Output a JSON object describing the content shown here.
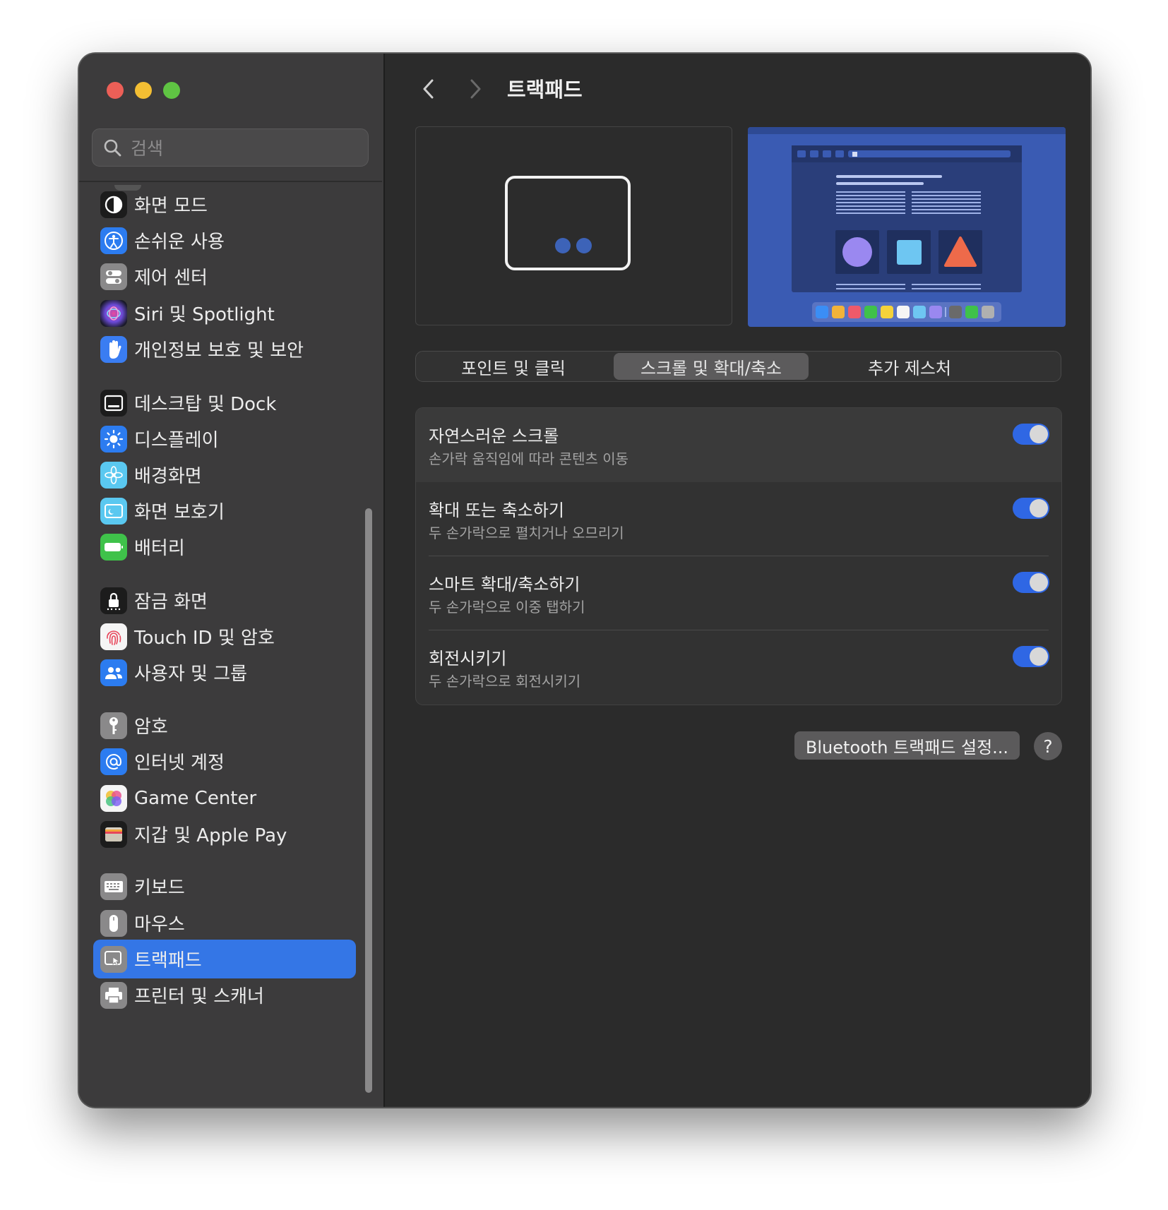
{
  "window": {
    "title": "트랙패드"
  },
  "search": {
    "placeholder": "검색",
    "value": ""
  },
  "sidebar": {
    "items": [
      {
        "label": "화면 모드",
        "icon": "appearance-icon"
      },
      {
        "label": "손쉬운 사용",
        "icon": "accessibility-icon"
      },
      {
        "label": "제어 센터",
        "icon": "control-center-icon"
      },
      {
        "label": "Siri 및 Spotlight",
        "icon": "siri-icon"
      },
      {
        "label": "개인정보 보호 및 보안",
        "icon": "privacy-hand-icon"
      },
      {
        "label": "데스크탑 및 Dock",
        "icon": "desktop-dock-icon"
      },
      {
        "label": "디스플레이",
        "icon": "display-sun-icon"
      },
      {
        "label": "배경화면",
        "icon": "wallpaper-flower-icon"
      },
      {
        "label": "화면 보호기",
        "icon": "screensaver-icon"
      },
      {
        "label": "배터리",
        "icon": "battery-icon"
      },
      {
        "label": "잠금 화면",
        "icon": "lock-screen-icon"
      },
      {
        "label": "Touch ID 및 암호",
        "icon": "fingerprint-icon"
      },
      {
        "label": "사용자 및 그룹",
        "icon": "users-icon"
      },
      {
        "label": "암호",
        "icon": "key-icon"
      },
      {
        "label": "인터넷 계정",
        "icon": "at-sign-icon"
      },
      {
        "label": "Game Center",
        "icon": "game-center-icon"
      },
      {
        "label": "지갑 및 Apple Pay",
        "icon": "wallet-icon"
      },
      {
        "label": "키보드",
        "icon": "keyboard-icon"
      },
      {
        "label": "마우스",
        "icon": "mouse-icon"
      },
      {
        "label": "트랙패드",
        "icon": "trackpad-icon",
        "selected": true
      },
      {
        "label": "프린터 및 스캐너",
        "icon": "printer-icon"
      }
    ]
  },
  "tabs": [
    {
      "label": "포인트 및 클릭"
    },
    {
      "label": "스크롤 및 확대/축소",
      "selected": true
    },
    {
      "label": "추가 제스처"
    }
  ],
  "settings": [
    {
      "title": "자연스러운 스크롤",
      "subtitle": "손가락 움직임에 따라 콘텐츠 이동",
      "enabled": true
    },
    {
      "title": "확대 또는 축소하기",
      "subtitle": "두 손가락으로 펼치거나 오므리기",
      "enabled": true
    },
    {
      "title": "스마트 확대/축소하기",
      "subtitle": "두 손가락으로 이중 탭하기",
      "enabled": true
    },
    {
      "title": "회전시키기",
      "subtitle": "두 손가락으로 회전시키기",
      "enabled": true
    }
  ],
  "buttons": {
    "bluetooth": "Bluetooth 트랙패드 설정...",
    "help": "?"
  },
  "colors": {
    "accent": "#3476e6",
    "toggle_on": "#2f67e4",
    "preview_bg": "#3a5bb3"
  }
}
